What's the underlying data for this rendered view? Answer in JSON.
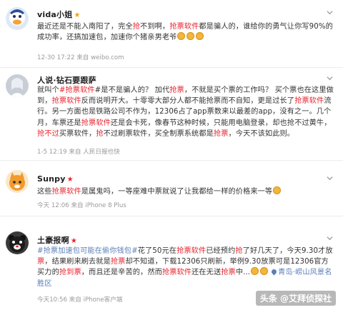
{
  "posts": [
    {
      "username": "vida小姐",
      "vip_mark": "★",
      "body_segments": [
        {
          "t": "最近还是不能入南阳了，完全"
        },
        {
          "t": "抢",
          "c": "red"
        },
        {
          "t": "不到啊，"
        },
        {
          "t": "抢票软件",
          "c": "red"
        },
        {
          "t": "都是骗人的，谁给你的勇气让你写90%的成功率，还搞加速包，加速你个猪亲男老爷"
        }
      ],
      "emoji_count": 3,
      "meta": "12-30 17:22 来自 weibo.com"
    },
    {
      "username": "人说·钻石要跟萨",
      "body_segments": [
        {
          "t": "就叫个"
        },
        {
          "t": "#抢票软件",
          "c": "red"
        },
        {
          "t": "#是不是骗人的？ 加代"
        },
        {
          "t": "抢票",
          "c": "red"
        },
        {
          "t": "，不就是买个票的工作吗？ 买个票也在这里做到，"
        },
        {
          "t": "抢票软件",
          "c": "red"
        },
        {
          "t": "反而说明开大。十零零大部分人都不能抢票而不自知，更是过长了"
        },
        {
          "t": "抢票软件",
          "c": "red"
        },
        {
          "t": "流行。另一方面也是铁路公司不作为，12306占了app票数来以最差的app，没有之一。几个月，车票还是"
        },
        {
          "t": "抢票软件",
          "c": "red"
        },
        {
          "t": "还是会卡死，像春节这种时候，只能用电脑登录，却也抢不过黄牛，"
        },
        {
          "t": "抢不过",
          "c": "red"
        },
        {
          "t": "买票软件，"
        },
        {
          "t": "抢",
          "c": "red"
        },
        {
          "t": "不过刷票软件，买全制票系统都是"
        },
        {
          "t": "抢票",
          "c": "red"
        },
        {
          "t": "，今天不该如此则。"
        }
      ],
      "meta": "1-5 12:19 来自 人民日报也快"
    },
    {
      "username": "Sunpy",
      "vip_mark": "★",
      "body_segments": [
        {
          "t": "这些"
        },
        {
          "t": "抢票软件",
          "c": "red"
        },
        {
          "t": "是属鬼吗，一等座难中票就说了让我都给一样的价格来一等"
        }
      ],
      "emoji_count": 1,
      "meta": "今天 12:06 来自 iPhone 8 Plus"
    },
    {
      "username": "土豪报啊",
      "vip_mark": "★",
      "body_segments": [
        {
          "t": "#抢票加速包可能在偷你钱包#",
          "c": "blue"
        },
        {
          "t": "花了50元在"
        },
        {
          "t": "抢票软件",
          "c": "red"
        },
        {
          "t": "已经预约"
        },
        {
          "t": "抢",
          "c": "red"
        },
        {
          "t": "了好几天了，今天9.30才放"
        },
        {
          "t": "票",
          "c": "red"
        },
        {
          "t": "，结果刷来刷去就是"
        },
        {
          "t": "抢票",
          "c": "red"
        },
        {
          "t": "却不知道，下载12306只刷新，举例9.30放票可是12306官方买力的"
        },
        {
          "t": "抢到票",
          "c": "red"
        },
        {
          "t": "，而且还是辛苦的，然而"
        },
        {
          "t": "抢票软件",
          "c": "red"
        },
        {
          "t": "还在无送"
        },
        {
          "t": "抢票",
          "c": "red"
        },
        {
          "t": "中..."
        }
      ],
      "emoji_count": 2,
      "location": "青岛·崂山风景名胜区",
      "meta": "今天10:56 来自 iPhone客户端"
    }
  ],
  "watermark": "头条 @艾拜侦探社"
}
